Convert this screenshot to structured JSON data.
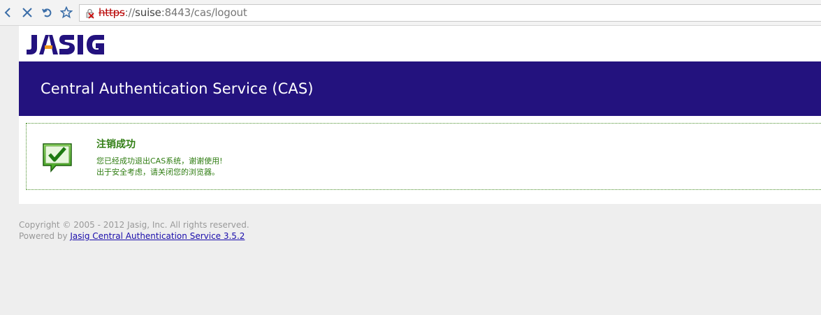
{
  "browser": {
    "url_scheme": "https",
    "url_sep": "://",
    "url_host": "suise",
    "url_port": ":8443",
    "url_path": "/cas/logout",
    "icons": [
      "back-icon",
      "stop-icon",
      "reload-icon",
      "bookmark-star-icon",
      "insecure-lock-icon"
    ]
  },
  "header": {
    "logo_text": "JASIG",
    "title": "Central Authentication Service (CAS)"
  },
  "message": {
    "title": "注销成功",
    "line1": "您已经成功退出CAS系统，谢谢使用!",
    "line2": "出于安全考虑，请关闭您的浏览器。",
    "icon": "success-check-icon"
  },
  "footer": {
    "copyright": "Copyright © 2005 - 2012 Jasig, Inc. All rights reserved.",
    "powered_by_prefix": "Powered by ",
    "powered_by_link": "Jasig Central Authentication Service 3.5.2"
  },
  "colors": {
    "banner": "#23127e",
    "success": "#2f7d12",
    "link": "#1a0dab"
  }
}
